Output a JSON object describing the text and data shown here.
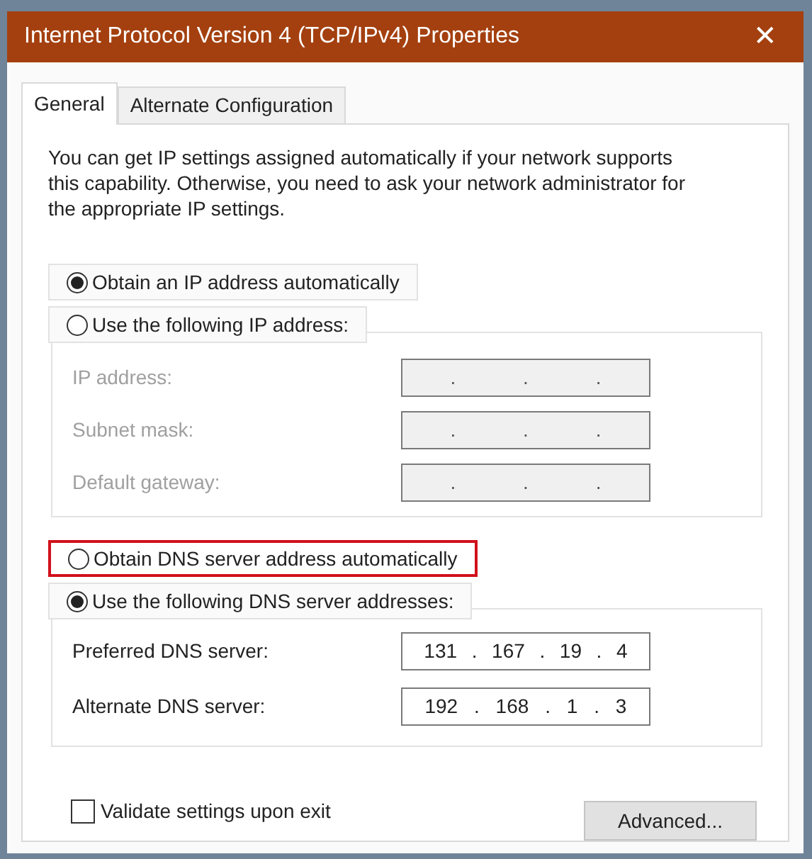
{
  "window": {
    "title": "Internet Protocol Version 4 (TCP/IPv4) Properties",
    "close": "✕"
  },
  "tabs": [
    {
      "label": "General",
      "selected": true
    },
    {
      "label": "Alternate Configuration",
      "selected": false
    }
  ],
  "description": "You can get IP settings assigned automatically if your network supports this capability. Otherwise, you need to ask your network administrator for the appropriate IP settings.",
  "ip_options": [
    {
      "label": "Obtain an IP address automatically",
      "selected": true,
      "highlighted": false
    },
    {
      "label": "Use the following IP address:",
      "selected": false,
      "highlighted": false
    }
  ],
  "ip_fields": [
    {
      "label": "IP address:",
      "disabled": true,
      "parts": [
        ".",
        ".",
        "."
      ]
    },
    {
      "label": "Subnet mask:",
      "disabled": true,
      "parts": [
        ".",
        ".",
        "."
      ]
    },
    {
      "label": "Default gateway:",
      "disabled": true,
      "parts": [
        ".",
        ".",
        "."
      ]
    }
  ],
  "dns_options": [
    {
      "label": "Obtain DNS server address automatically",
      "selected": false,
      "highlighted": true
    },
    {
      "label": "Use the following DNS server addresses:",
      "selected": true,
      "highlighted": false
    }
  ],
  "dns_fields": [
    {
      "label": "Preferred DNS server:",
      "disabled": false,
      "parts": [
        "131",
        ".",
        "167",
        ".",
        "19",
        ".",
        "4"
      ]
    },
    {
      "label": "Alternate DNS server:",
      "disabled": false,
      "parts": [
        "192",
        ".",
        "168",
        ".",
        "1",
        ".",
        "3"
      ]
    }
  ],
  "validate": {
    "label": "Validate settings upon exit",
    "checked": false
  },
  "advanced_button": "Advanced..."
}
